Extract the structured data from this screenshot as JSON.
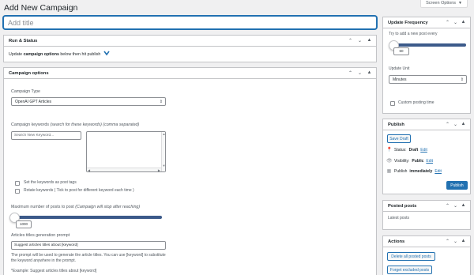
{
  "screen_options": {
    "label": "Screen Options"
  },
  "page": {
    "title": "Add New Campaign"
  },
  "title_input": {
    "placeholder": "Add title"
  },
  "run_status": {
    "heading": "Run & Status",
    "text_before": "Update ",
    "text_bold": "campaign options",
    "text_after": " below then hit publish"
  },
  "campaign_options": {
    "heading": "Campaign options",
    "campaign_type_label": "Campaign Type",
    "campaign_type_value": "OpenAI GPT Articles",
    "keywords_label": "Campaign keywords",
    "keywords_hint": "(search for these keywords) (comma separated)",
    "keyword_search_placeholder": "Search New Keyword...",
    "set_keywords_tags_label": "Set the keywords as post tags",
    "rotate_keywords_label": "Rotate keywords ( Tick to post for different keyword each time )",
    "max_posts_label": "Maximum number of posts to post",
    "max_posts_hint": "(Campaign will stop after reaching)",
    "max_posts_value": "1000",
    "prompt_label": "Articles titles generation prompt",
    "prompt_value": "Suggest articles titles about [keyword]",
    "prompt_help": "The prompt will be used to generate the article titles. You can use [keyword] to substitute the keyword anywhere in the prompt.",
    "prompt_example": "*Example: Suggest articles titles about [keyword]"
  },
  "update_frequency": {
    "heading": "Update Frequency",
    "try_text": "Try to add a new post every",
    "slider_value": "60",
    "unit_label": "Update Unit",
    "unit_value": "Minutes",
    "custom_time_label": "Custom posting time"
  },
  "publish": {
    "heading": "Publish",
    "save_draft": "Save Draft",
    "status_label": "Status: ",
    "status_value": "Draft",
    "visibility_label": "Visibility: ",
    "visibility_value": "Public",
    "publish_label": "Publish ",
    "publish_value": "immediately",
    "edit": "Edit",
    "publish_button": "Publish"
  },
  "posted_posts": {
    "heading": "Posted posts",
    "latest": "Latest posts"
  },
  "actions": {
    "heading": "Actions",
    "delete_all": "Delete all posted posts",
    "forget_excluded": "Forget excluded posts"
  },
  "colors": {
    "accent": "#2271b1",
    "slider": "#3c5a8a",
    "background": "#f0f0f1"
  }
}
